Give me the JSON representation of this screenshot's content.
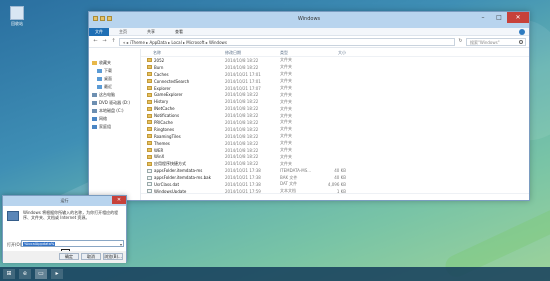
{
  "desktop": {
    "icon_label": "回收站"
  },
  "explorer": {
    "title": "Windows",
    "ribbon_tabs": [
      "文件",
      "主页",
      "共享",
      "查看"
    ],
    "address": "« ▸ iTheme ▸ AppData ▸ Local ▸ Microsoft ▸ Windows",
    "search_placeholder": "搜索\"Windows\"",
    "nav_items": [
      {
        "label": "收藏夹",
        "indent": false,
        "icon": "star-icon"
      },
      {
        "label": "下载",
        "indent": true,
        "icon": "folder-icon"
      },
      {
        "label": "桌面",
        "indent": true,
        "icon": "folder-icon"
      },
      {
        "label": "最近",
        "indent": true,
        "icon": "folder-icon"
      },
      {
        "label": "这台电脑",
        "indent": false,
        "icon": "computer-icon"
      },
      {
        "label": "DVD 驱动器 (D:)",
        "indent": false,
        "icon": "dvd-icon"
      },
      {
        "label": "本地磁盘 (C:)",
        "indent": false,
        "icon": "drive-icon"
      },
      {
        "label": "网络",
        "indent": false,
        "icon": "network-icon"
      },
      {
        "label": "家庭组",
        "indent": false,
        "icon": "homegroup-icon"
      }
    ],
    "columns": [
      "名称",
      "修改日期",
      "类型",
      "大小"
    ],
    "rows": [
      {
        "name": "2052",
        "date": "2014/10/8 18:22",
        "type": "文件夹",
        "size": "",
        "folder": true
      },
      {
        "name": "Burn",
        "date": "2014/10/8 18:22",
        "type": "文件夹",
        "size": "",
        "folder": true
      },
      {
        "name": "Caches",
        "date": "2014/10/21 17:01",
        "type": "文件夹",
        "size": "",
        "folder": true
      },
      {
        "name": "ConnectedSearch",
        "date": "2014/10/21 17:01",
        "type": "文件夹",
        "size": "",
        "folder": true
      },
      {
        "name": "Explorer",
        "date": "2014/10/21 17:07",
        "type": "文件夹",
        "size": "",
        "folder": true
      },
      {
        "name": "GameExplorer",
        "date": "2014/10/8 18:22",
        "type": "文件夹",
        "size": "",
        "folder": true
      },
      {
        "name": "History",
        "date": "2014/10/8 18:22",
        "type": "文件夹",
        "size": "",
        "folder": true
      },
      {
        "name": "INetCache",
        "date": "2014/10/8 18:22",
        "type": "文件夹",
        "size": "",
        "folder": true
      },
      {
        "name": "Notifications",
        "date": "2014/10/8 18:22",
        "type": "文件夹",
        "size": "",
        "folder": true
      },
      {
        "name": "PRICache",
        "date": "2014/10/8 18:22",
        "type": "文件夹",
        "size": "",
        "folder": true
      },
      {
        "name": "Ringtones",
        "date": "2014/10/8 18:22",
        "type": "文件夹",
        "size": "",
        "folder": true
      },
      {
        "name": "RoamingTiles",
        "date": "2014/10/8 18:22",
        "type": "文件夹",
        "size": "",
        "folder": true
      },
      {
        "name": "Themes",
        "date": "2014/10/8 18:22",
        "type": "文件夹",
        "size": "",
        "folder": true
      },
      {
        "name": "WER",
        "date": "2014/10/8 18:22",
        "type": "文件夹",
        "size": "",
        "folder": true
      },
      {
        "name": "WinX",
        "date": "2014/10/8 18:22",
        "type": "文件夹",
        "size": "",
        "folder": true
      },
      {
        "name": "应用程序快捷方式",
        "date": "2014/10/8 18:22",
        "type": "文件夹",
        "size": "",
        "folder": true
      },
      {
        "name": "appsFolder.itemdata-ms",
        "date": "2014/10/21 17:38",
        "type": "ITEMDATA-MS...",
        "size": "40 KB",
        "folder": false
      },
      {
        "name": "appsFolder.itemdata-ms.bak",
        "date": "2014/10/21 17:38",
        "type": "BAK 文件",
        "size": "40 KB",
        "folder": false
      },
      {
        "name": "UsrClass.dat",
        "date": "2014/10/21 17:38",
        "type": "DAT 文件",
        "size": "4,096 KB",
        "folder": false
      },
      {
        "name": "WindowsUpdate",
        "date": "2014/10/21 17:59",
        "type": "文本文档",
        "size": "1 KB",
        "folder": false
      }
    ]
  },
  "run": {
    "title": "运行",
    "description": "Windows 将根据你所输入的名称，为你打开相应的程序、文件夹、文档或 Internet 资源。",
    "open_label": "打开(O):",
    "input_value": "%localAppdata%",
    "buttons": [
      "确定",
      "取消",
      "浏览(B)..."
    ]
  }
}
